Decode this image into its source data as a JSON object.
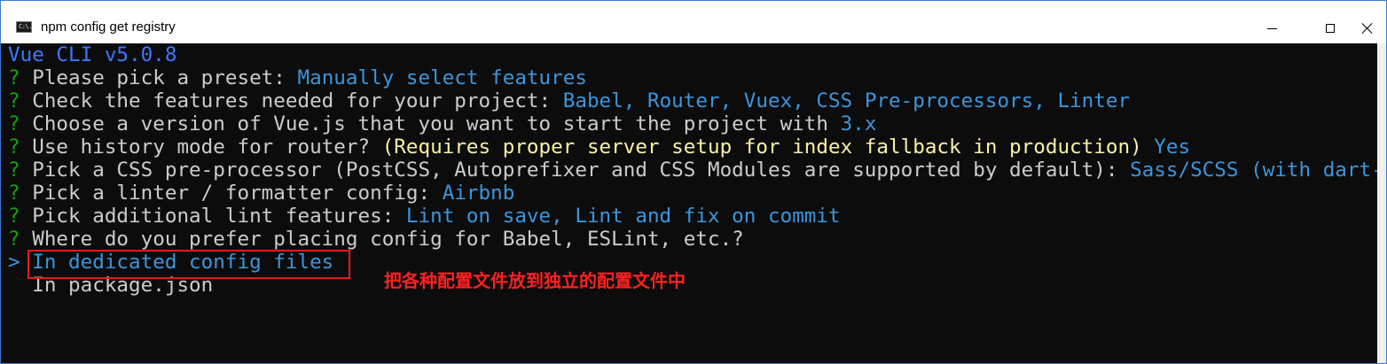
{
  "window": {
    "title": "npm config get registry",
    "icon": "cmd-icon",
    "icon_glyph": "C:\\."
  },
  "console": {
    "header": "Vue CLI v5.0.8",
    "prompt_mark": "?",
    "selector_mark": ">",
    "lines": [
      {
        "question": "Please pick a preset:",
        "hint": "",
        "answer": "Manually select features"
      },
      {
        "question": "Check the features needed for your project:",
        "hint": "",
        "answer": "Babel, Router, Vuex, CSS Pre-processors, Linter"
      },
      {
        "question": "Choose a version of Vue.js that you want to start the project with",
        "hint": "",
        "answer": "3.x"
      },
      {
        "question": "Use history mode for router?",
        "hint": "(Requires proper server setup for index fallback in production)",
        "answer": "Yes"
      },
      {
        "question": "Pick a CSS pre-processor (PostCSS, Autoprefixer and CSS Modules are supported by default):",
        "hint": "",
        "answer": "Sass/SCSS (with dart-sass)"
      },
      {
        "question": "Pick a linter / formatter config:",
        "hint": "",
        "answer": "Airbnb"
      },
      {
        "question": "Pick additional lint features:",
        "hint": "",
        "answer": "Lint on save, Lint and fix on commit"
      },
      {
        "question": "Where do you prefer placing config for Babel, ESLint, etc.?",
        "hint": "",
        "answer": ""
      }
    ],
    "options": [
      {
        "label": "In dedicated config files",
        "selected": true
      },
      {
        "label": "In package.json",
        "selected": false
      }
    ]
  },
  "annotation": {
    "text": "把各种配置文件放到独立的配置文件中",
    "color": "#ff2020"
  },
  "colors": {
    "background": "#0c0c0c",
    "prompt_green": "#13a10e",
    "answer_blue": "#3a96dd",
    "hint_yellow": "#f9f1a5",
    "header_blue": "#3b78ff",
    "highlight_red": "#e8191a"
  }
}
